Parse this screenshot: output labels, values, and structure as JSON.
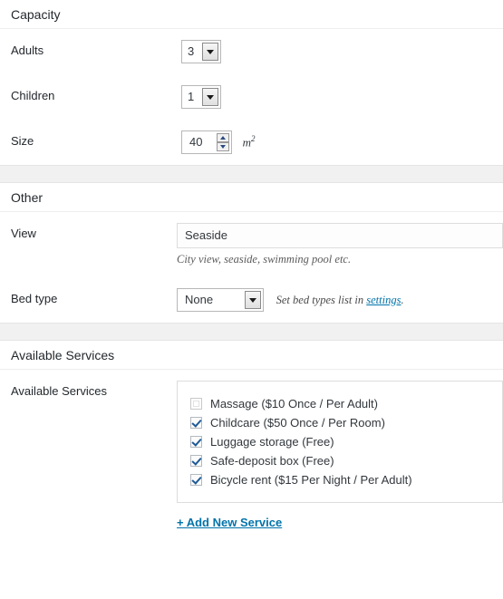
{
  "sections": {
    "capacity": {
      "heading": "Capacity",
      "rows": {
        "adults": {
          "label": "Adults",
          "value": "3"
        },
        "children": {
          "label": "Children",
          "value": "1"
        },
        "size": {
          "label": "Size",
          "value": "40",
          "unit": "m",
          "unit_exponent": "2"
        }
      }
    },
    "other": {
      "heading": "Other",
      "rows": {
        "view": {
          "label": "View",
          "value": "Seaside",
          "placeholder": "View",
          "hint": "City view, seaside, swimming pool etc."
        },
        "bed_type": {
          "label": "Bed type",
          "value": "None",
          "note_prefix": "Set bed types list in ",
          "note_link": "settings",
          "note_suffix": "."
        }
      }
    },
    "available_services": {
      "heading": "Available Services",
      "row_label": "Available Services",
      "items": [
        {
          "label": "Massage ($10 Once / Per Adult)",
          "checked": false
        },
        {
          "label": "Childcare ($50 Once / Per Room)",
          "checked": true
        },
        {
          "label": "Luggage storage (Free)",
          "checked": true
        },
        {
          "label": "Safe-deposit box (Free)",
          "checked": true
        },
        {
          "label": "Bicycle rent ($15 Per Night / Per Adult)",
          "checked": true
        }
      ],
      "add_link": "+ Add New Service"
    }
  },
  "colors": {
    "link": "#0073aa",
    "band": "#f1f1f1",
    "border": "#e5e5e5",
    "text": "#32373c",
    "heading": "#23282d"
  }
}
